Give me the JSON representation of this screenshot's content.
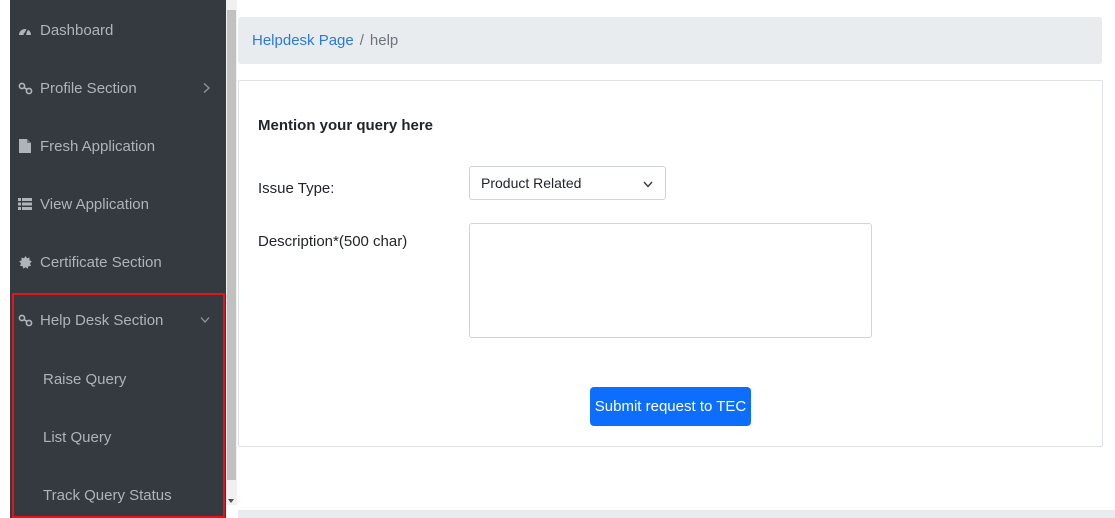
{
  "sidebar": {
    "items": [
      {
        "label": "Dashboard",
        "icon": "dashboard-icon"
      },
      {
        "label": "Profile Section",
        "icon": "link-icon",
        "chevron": "chevron-right-icon"
      },
      {
        "label": "Fresh Application",
        "icon": "file-icon"
      },
      {
        "label": "View Application",
        "icon": "list-icon"
      },
      {
        "label": "Certificate Section",
        "icon": "certificate-icon"
      },
      {
        "label": "Help Desk Section",
        "icon": "link-icon",
        "chevron": "chevron-down-icon"
      }
    ],
    "subitems": [
      {
        "label": "Raise Query"
      },
      {
        "label": "List Query"
      },
      {
        "label": "Track Query Status"
      }
    ]
  },
  "breadcrumb": {
    "link": "Helpdesk Page",
    "separator": "/",
    "current": "help"
  },
  "form": {
    "title": "Mention your query here",
    "issue_label": "Issue Type:",
    "issue_value": "Product Related",
    "description_label": "Description*(500 char)",
    "description_value": "",
    "submit_label": "Submit request to TEC"
  },
  "colors": {
    "sidebar_bg": "#343a40",
    "primary": "#0d6efd",
    "highlight": "#e3141b"
  }
}
